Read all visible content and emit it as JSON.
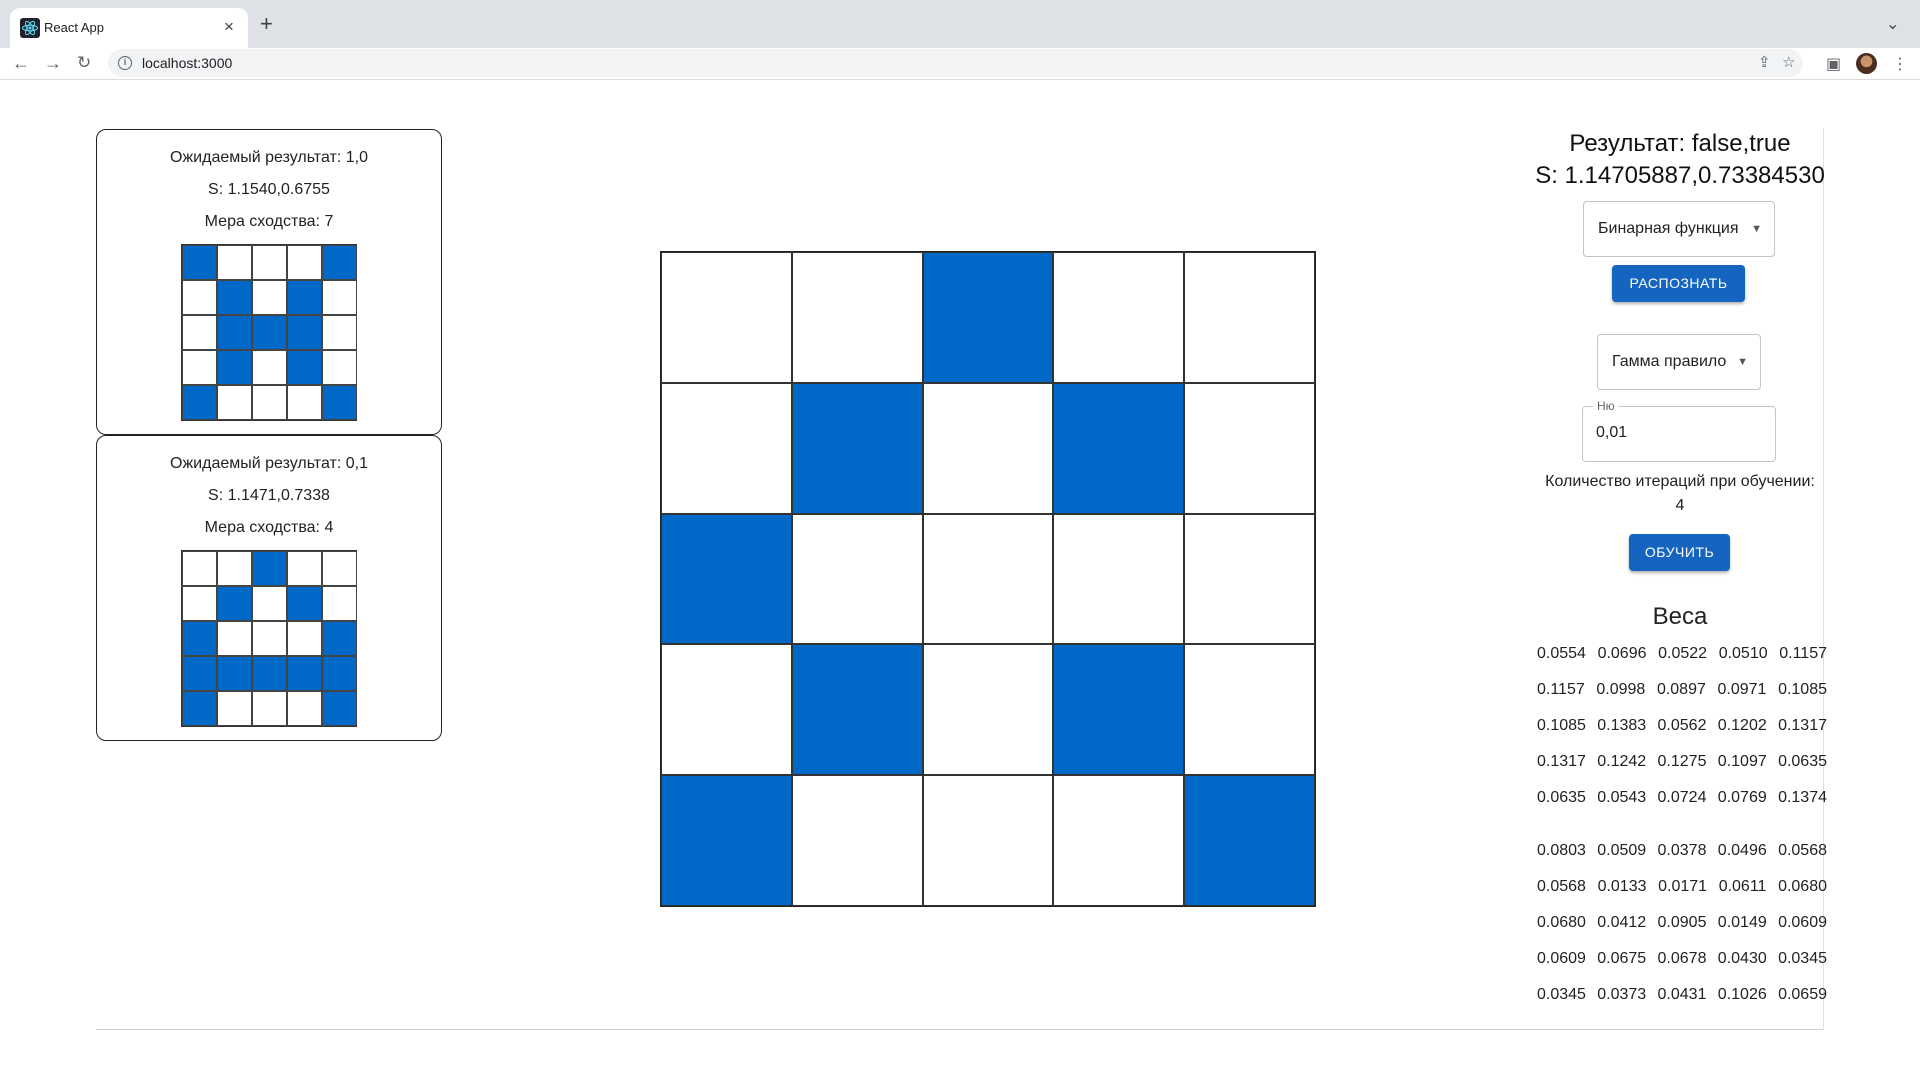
{
  "browser": {
    "tab_title": "React App",
    "tab_close": "×",
    "new_tab": "+",
    "url": "localhost:3000"
  },
  "cards": [
    {
      "expected": "Ожидаемый результат: 1,0",
      "s": "S: 1.1540,0.6755",
      "similarity": "Мера сходства: 7",
      "grid": [
        1,
        0,
        0,
        0,
        1,
        0,
        1,
        0,
        1,
        0,
        0,
        1,
        1,
        1,
        0,
        0,
        1,
        0,
        1,
        0,
        1,
        0,
        0,
        0,
        1
      ]
    },
    {
      "expected": "Ожидаемый результат: 0,1",
      "s": "S: 1.1471,0.7338",
      "similarity": "Мера сходства: 4",
      "grid": [
        0,
        0,
        1,
        0,
        0,
        0,
        1,
        0,
        1,
        0,
        1,
        0,
        0,
        0,
        1,
        1,
        1,
        1,
        1,
        1,
        1,
        0,
        0,
        0,
        1
      ]
    }
  ],
  "main_grid": [
    0,
    0,
    1,
    0,
    0,
    0,
    1,
    0,
    1,
    0,
    1,
    0,
    0,
    0,
    0,
    0,
    1,
    0,
    1,
    0,
    1,
    0,
    0,
    0,
    1
  ],
  "right_panel": {
    "result": "Результат: false,true",
    "s_value": "S: 1.14705887,0.73384530",
    "function_select": "Бинарная функция",
    "recognize_button": "РАСПОЗНАТЬ",
    "rule_select": "Гамма правило",
    "nu_label": "Ню",
    "nu_value": "0,01",
    "iterations_label": "Количество итераций при обучении:",
    "iterations_value": "4",
    "train_button": "ОБУЧИТЬ",
    "weights_title": "Веса",
    "weights_1": [
      [
        "0.0554",
        "0.0696",
        "0.0522",
        "0.0510",
        "0.1157"
      ],
      [
        "0.1157",
        "0.0998",
        "0.0897",
        "0.0971",
        "0.1085"
      ],
      [
        "0.1085",
        "0.1383",
        "0.0562",
        "0.1202",
        "0.1317"
      ],
      [
        "0.1317",
        "0.1242",
        "0.1275",
        "0.1097",
        "0.0635"
      ],
      [
        "0.0635",
        "0.0543",
        "0.0724",
        "0.0769",
        "0.1374"
      ]
    ],
    "weights_2": [
      [
        "0.0803",
        "0.0509",
        "0.0378",
        "0.0496",
        "0.0568"
      ],
      [
        "0.0568",
        "0.0133",
        "0.0171",
        "0.0611",
        "0.0680"
      ],
      [
        "0.0680",
        "0.0412",
        "0.0905",
        "0.0149",
        "0.0609"
      ],
      [
        "0.0609",
        "0.0675",
        "0.0678",
        "0.0430",
        "0.0345"
      ],
      [
        "0.0345",
        "0.0373",
        "0.0431",
        "0.1026",
        "0.0659"
      ]
    ]
  },
  "colors": {
    "cell_on": "#0069c8",
    "button": "#1565c0"
  }
}
